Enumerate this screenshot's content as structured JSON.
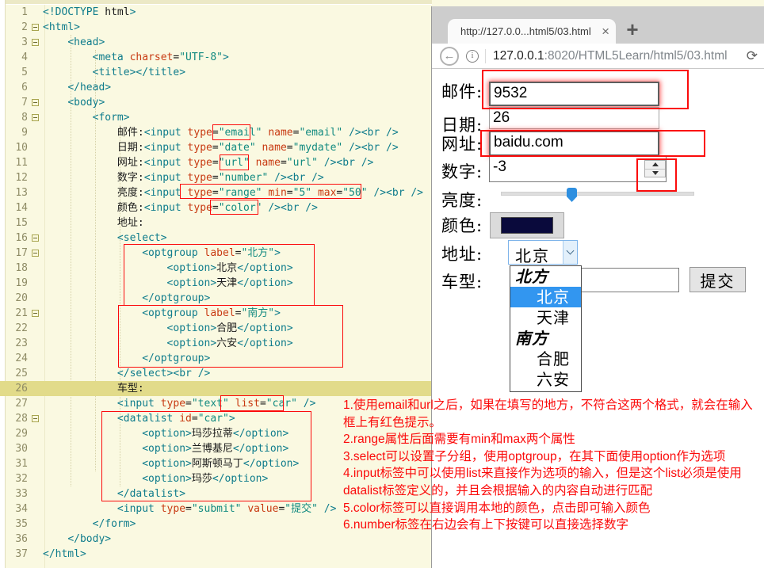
{
  "colors": {
    "annotation_red": "#FB0B0B",
    "selection_blue": "#3296F0",
    "swatch_navy": "#0A0A3C"
  },
  "editor": {
    "lines": [
      {
        "n": "1",
        "text": "<!DOCTYPE html>"
      },
      {
        "n": "2",
        "fold": true,
        "text": "<html>"
      },
      {
        "n": "3",
        "fold": true,
        "text": "    <head>"
      },
      {
        "n": "4",
        "text": "        <meta charset=\"UTF-8\">"
      },
      {
        "n": "5",
        "text": "        <title></title>"
      },
      {
        "n": "6",
        "text": "    </head>"
      },
      {
        "n": "7",
        "fold": true,
        "text": "    <body>"
      },
      {
        "n": "8",
        "fold": true,
        "text": "        <form>"
      },
      {
        "n": "9",
        "text": "            邮件:<input type=\"email\" name=\"email\" /><br />"
      },
      {
        "n": "10",
        "text": "            日期:<input type=\"date\" name=\"mydate\" /><br />"
      },
      {
        "n": "11",
        "text": "            网址:<input type=\"url\" name=\"url\" /><br />"
      },
      {
        "n": "12",
        "text": "            数字:<input type=\"number\" /><br />"
      },
      {
        "n": "13",
        "text": "            亮度:<input type=\"range\" min=\"5\" max=\"50\" /><br />"
      },
      {
        "n": "14",
        "text": "            颜色:<input type=\"color\" /><br />"
      },
      {
        "n": "15",
        "text": "            地址:"
      },
      {
        "n": "16",
        "fold": true,
        "text": "            <select>"
      },
      {
        "n": "17",
        "fold": true,
        "text": "                <optgroup label=\"北方\">"
      },
      {
        "n": "18",
        "text": "                    <option>北京</option>"
      },
      {
        "n": "19",
        "text": "                    <option>天津</option>"
      },
      {
        "n": "20",
        "text": "                </optgroup>"
      },
      {
        "n": "21",
        "fold": true,
        "text": "                <optgroup label=\"南方\">"
      },
      {
        "n": "22",
        "text": "                    <option>合肥</option>"
      },
      {
        "n": "23",
        "text": "                    <option>六安</option>"
      },
      {
        "n": "24",
        "text": "                </optgroup>"
      },
      {
        "n": "25",
        "text": "            </select><br />"
      },
      {
        "n": "26",
        "hl": true,
        "text": "            车型:"
      },
      {
        "n": "27",
        "text": "            <input type=\"text\" list=\"car\" />"
      },
      {
        "n": "28",
        "fold": true,
        "text": "            <datalist id=\"car\">"
      },
      {
        "n": "29",
        "text": "                <option>玛莎拉蒂</option>"
      },
      {
        "n": "30",
        "text": "                <option>兰博基尼</option>"
      },
      {
        "n": "31",
        "text": "                <option>阿斯顿马丁</option>"
      },
      {
        "n": "32",
        "text": "                <option>玛莎</option>"
      },
      {
        "n": "33",
        "text": "            </datalist>"
      },
      {
        "n": "34",
        "text": "            <input type=\"submit\" value=\"提交\" />"
      },
      {
        "n": "35",
        "text": "        </form>"
      },
      {
        "n": "36",
        "text": "    </body>"
      },
      {
        "n": "37",
        "text": "</html>"
      }
    ]
  },
  "browser": {
    "tab_title": "http://127.0.0...html5/03.html",
    "close_label": "×",
    "new_tab_label": "+",
    "back_label": "←",
    "info_label": "i",
    "url_host": "127.0.0.1",
    "url_rest": ":8020/HTML5Learn/html5/03.html",
    "reload_label": "⟳"
  },
  "form": {
    "email": {
      "label": "邮件:",
      "value": "9532"
    },
    "date": {
      "label": "日期:",
      "value": "26"
    },
    "url": {
      "label": "网址:",
      "value": "baidu.com"
    },
    "number": {
      "label": "数字:",
      "value": "-3"
    },
    "range": {
      "label": "亮度:",
      "min": "5",
      "max": "50"
    },
    "color": {
      "label": "颜色:"
    },
    "address": {
      "label": "地址:",
      "selected": "北京",
      "dropdown": [
        {
          "text": "北方",
          "group": true
        },
        {
          "text": "北京",
          "selected": true
        },
        {
          "text": "天津"
        },
        {
          "text": "南方",
          "group": true
        },
        {
          "text": "合肥"
        },
        {
          "text": "六安"
        }
      ]
    },
    "car": {
      "label": "车型:",
      "value": ""
    },
    "submit_label": "提交"
  },
  "notes": {
    "items": [
      "1.使用email和url之后，如果在填写的地方，不符合这两个格式，就会在输入框上有红色提示。",
      "2.range属性后面需要有min和max两个属性",
      "3.select可以设置子分组，使用optgroup，在其下面使用option作为选项",
      "4.input标签中可以使用list来直接作为选项的输入，但是这个list必须是使用datalist标签定义的，并且会根据输入的内容自动进行匹配",
      "5.color标签可以直接调用本地的颜色，点击即可输入颜色",
      "6.number标签在右边会有上下按键可以直接选择数字"
    ]
  }
}
